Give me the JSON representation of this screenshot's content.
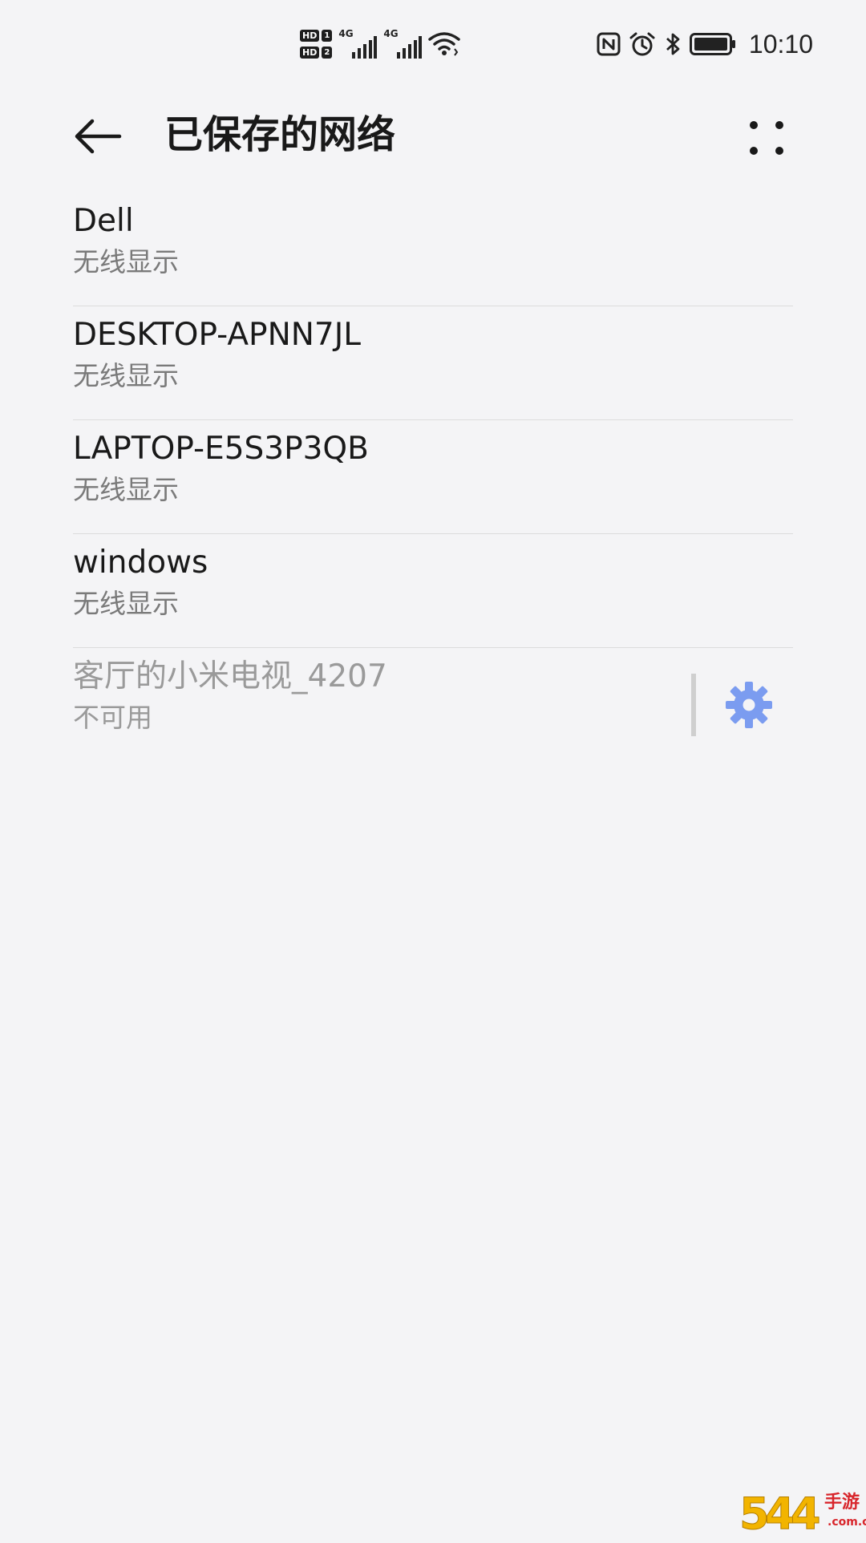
{
  "status_bar": {
    "hd1": "HD",
    "hd1_num": "1",
    "hd2": "HD",
    "hd2_num": "2",
    "sim1_label": "4G",
    "sim2_label": "4G",
    "time": "10:10",
    "icons": [
      "nfc-icon",
      "alarm-icon",
      "bluetooth-icon",
      "battery-icon"
    ]
  },
  "header": {
    "title": "已保存的网络",
    "back_icon": "back-arrow-icon",
    "more_icon": "more-options-icon"
  },
  "networks": [
    {
      "name": "Dell",
      "status": "无线显示"
    },
    {
      "name": "DESKTOP-APNN7JL",
      "status": "无线显示"
    },
    {
      "name": "LAPTOP-E5S3P3QB",
      "status": "无线显示"
    },
    {
      "name": "windows",
      "status": "无线显示"
    },
    {
      "name": "客厅的小米电视_4207",
      "status": "不可用",
      "has_settings": true
    }
  ],
  "colors": {
    "background": "#f4f4f6",
    "text_primary": "#191919",
    "text_secondary": "#7a7a7a",
    "text_disabled": "#9a9a9a",
    "accent_gear": "#7b9cf0",
    "divider": "#dcdcdc"
  }
}
